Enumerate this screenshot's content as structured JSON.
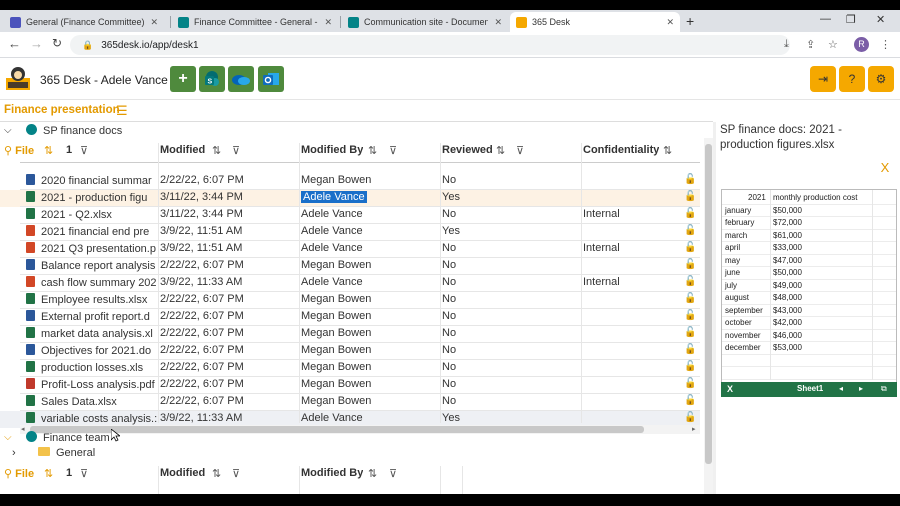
{
  "browser": {
    "tabs": [
      {
        "label": "General (Finance Committee) | M",
        "color": "#4b53bc"
      },
      {
        "label": "Finance Committee - General - A",
        "color": "#038387"
      },
      {
        "label": "Communication site - Document",
        "color": "#038387"
      },
      {
        "label": "365 Desk",
        "color": "#f5a800"
      }
    ],
    "url": "365desk.io/app/desk1",
    "avatar": "R"
  },
  "app": {
    "title": "365 Desk - Adele Vance"
  },
  "section": {
    "title": "Finance presentation"
  },
  "library1": {
    "name": "SP finance docs",
    "headers": {
      "file": "File",
      "count": "1",
      "modified": "Modified",
      "modified_by": "Modified By",
      "reviewed": "Reviewed",
      "confidentiality": "Confidentiality"
    },
    "rows": [
      {
        "name": "2020 financial summar",
        "modified": "2/22/22, 6:07 PM",
        "by": "Megan Bowen",
        "reviewed": "No",
        "conf": "",
        "type": "word"
      },
      {
        "name": "2021 - production figu",
        "modified": "3/11/22, 3:44 PM",
        "by": "Adele Vance",
        "reviewed": "Yes",
        "conf": "",
        "type": "excel"
      },
      {
        "name": "2021 - Q2.xlsx",
        "modified": "3/11/22, 3:44 PM",
        "by": "Adele Vance",
        "reviewed": "No",
        "conf": "Internal",
        "type": "excel"
      },
      {
        "name": "2021 financial end pre",
        "modified": "3/9/22, 11:51 AM",
        "by": "Adele Vance",
        "reviewed": "Yes",
        "conf": "",
        "type": "ppt"
      },
      {
        "name": "2021 Q3 presentation.p",
        "modified": "3/9/22, 11:51 AM",
        "by": "Adele Vance",
        "reviewed": "No",
        "conf": "Internal",
        "type": "ppt"
      },
      {
        "name": "Balance report analysis",
        "modified": "2/22/22, 6:07 PM",
        "by": "Megan Bowen",
        "reviewed": "No",
        "conf": "",
        "type": "word"
      },
      {
        "name": "cash flow summary 202",
        "modified": "3/9/22, 11:33 AM",
        "by": "Adele Vance",
        "reviewed": "No",
        "conf": "Internal",
        "type": "ppt"
      },
      {
        "name": "Employee results.xlsx",
        "modified": "2/22/22, 6:07 PM",
        "by": "Megan Bowen",
        "reviewed": "No",
        "conf": "",
        "type": "excel"
      },
      {
        "name": "External profit report.d",
        "modified": "2/22/22, 6:07 PM",
        "by": "Megan Bowen",
        "reviewed": "No",
        "conf": "",
        "type": "word"
      },
      {
        "name": "market data analysis.xl",
        "modified": "2/22/22, 6:07 PM",
        "by": "Megan Bowen",
        "reviewed": "No",
        "conf": "",
        "type": "excel"
      },
      {
        "name": "Objectives for 2021.do",
        "modified": "2/22/22, 6:07 PM",
        "by": "Megan Bowen",
        "reviewed": "No",
        "conf": "",
        "type": "word"
      },
      {
        "name": "production losses.xls",
        "modified": "2/22/22, 6:07 PM",
        "by": "Megan Bowen",
        "reviewed": "No",
        "conf": "",
        "type": "excel"
      },
      {
        "name": "Profit-Loss analysis.pdf",
        "modified": "2/22/22, 6:07 PM",
        "by": "Megan Bowen",
        "reviewed": "No",
        "conf": "",
        "type": "pdf"
      },
      {
        "name": "Sales Data.xlsx",
        "modified": "2/22/22, 6:07 PM",
        "by": "Megan Bowen",
        "reviewed": "No",
        "conf": "",
        "type": "excel"
      },
      {
        "name": "variable costs analysis.:",
        "modified": "3/9/22, 11:33 AM",
        "by": "Adele Vance",
        "reviewed": "Yes",
        "conf": "",
        "type": "excel"
      }
    ]
  },
  "library2": {
    "name": "Finance team",
    "child": "General",
    "headers": {
      "file": "File",
      "count": "1",
      "modified": "Modified",
      "modified_by": "Modified By"
    }
  },
  "preview": {
    "title": "SP finance docs: 2021 - production figures.xlsx",
    "close": "X",
    "sheet_header": [
      "2021",
      "monthly production cost"
    ],
    "sheet_rows": [
      [
        "january",
        "$50,000"
      ],
      [
        "february",
        "$72,000"
      ],
      [
        "march",
        "$61,000"
      ],
      [
        "april",
        "$33,000"
      ],
      [
        "may",
        "$47,000"
      ],
      [
        "june",
        "$50,000"
      ],
      [
        "july",
        "$49,000"
      ],
      [
        "august",
        "$48,000"
      ],
      [
        "september",
        "$43,000"
      ],
      [
        "october",
        "$42,000"
      ],
      [
        "november",
        "$46,000"
      ],
      [
        "december",
        "$53,000"
      ]
    ],
    "sheet_tab": "Sheet1"
  },
  "colors": {
    "accent": "#e39a00",
    "excel": "#217346",
    "word": "#2b579a",
    "ppt": "#d24726",
    "pdf": "#c0392b",
    "green_btn": "#4f8a3d"
  }
}
